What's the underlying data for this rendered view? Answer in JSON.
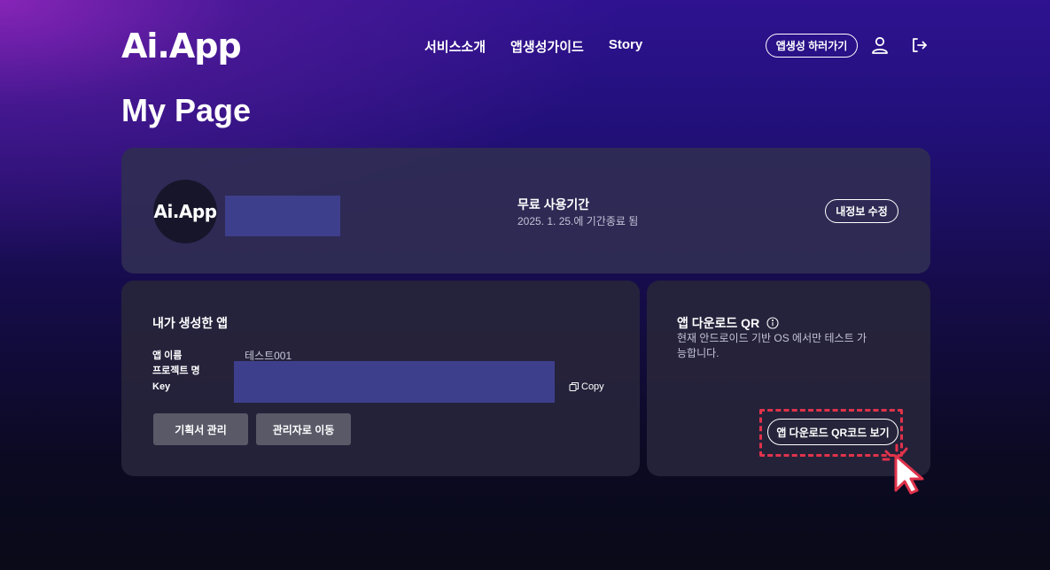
{
  "header": {
    "logo": "Ai.App",
    "nav": [
      "서비스소개",
      "앱생성가이드",
      "Story"
    ],
    "cta_label": "앱생성 하러가기",
    "user_icon": "user-icon",
    "logout_icon": "logout-icon"
  },
  "page_title": "My Page",
  "profile": {
    "avatar_text": "Ai.App",
    "period_title": "무료 사용기간",
    "period_sub": "2025. 1. 25.에 기간종료 됨",
    "edit_label": "내정보 수정"
  },
  "apps": {
    "title": "내가 생성한 앱",
    "labels": {
      "app_name": "앱 이름",
      "project_name": "프로젝트 명",
      "key": "Key"
    },
    "app_name_value": "테스트001",
    "copy_label": "Copy",
    "plan_button": "기획서 관리",
    "admin_button": "관리자로 이동"
  },
  "qr": {
    "title": "앱 다운로드 QR",
    "info_icon": "info-icon",
    "desc": "현재 안드로이드 기반 OS 에서만 테스트 가능합니다.",
    "button_label": "앱 다운로드 QR코드 보기"
  },
  "colors": {
    "accent_highlight": "#e0334b",
    "redacted_box": "#3e3f8c",
    "card_bg": "#302c54"
  }
}
